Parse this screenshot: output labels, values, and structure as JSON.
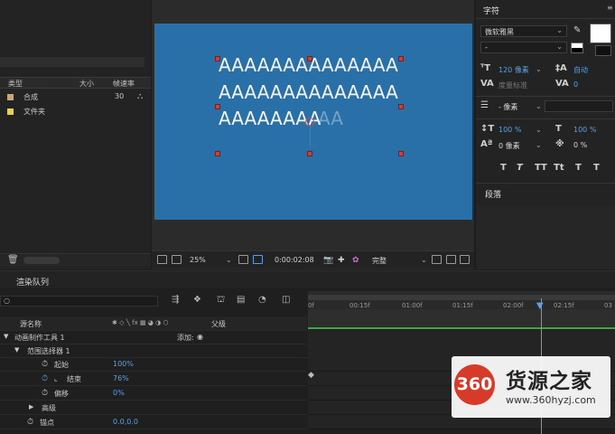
{
  "project": {
    "columns": [
      "类型",
      "大小",
      "帧速率"
    ],
    "items": [
      {
        "name": "合成",
        "fps": "30",
        "color": "#c9a77a"
      },
      {
        "name": "文件夹",
        "fps": "",
        "color": "#e5d15a"
      }
    ]
  },
  "canvas": {
    "lines": [
      "AAAAAAAAAAAAAA",
      "AAAAAAAAAAAAAA",
      "AAAAAAAA"
    ],
    "ghost": "AA",
    "bg_color": "#2a70a8"
  },
  "viewer_toolbar": {
    "zoom": "25%",
    "timecode": "0:00:02:08",
    "resolution": "完整"
  },
  "character": {
    "title": "字符",
    "font_family": "微软雅黑",
    "font_style": "-",
    "font_size": "120 像素",
    "leading": "自动",
    "kerning": "度量标准",
    "tracking": "0",
    "stroke_width": "- 像素",
    "vscale": "100 %",
    "hscale": "100 %",
    "baseline": "0 像素",
    "tsume": "0 %",
    "styles": [
      "T",
      "T",
      "TT",
      "Tt",
      "T",
      "T"
    ]
  },
  "paragraph": {
    "title": "段落"
  },
  "render_queue": {
    "tab": "渲染队列"
  },
  "timeline": {
    "header_source": "源名称",
    "header_parent": "父级",
    "add_label": "添加:",
    "rows": [
      {
        "label": "动画制作工具 1",
        "value": ""
      },
      {
        "label": "范围选择器 1",
        "value": ""
      },
      {
        "label": "起始",
        "value": "100%"
      },
      {
        "label": "结束",
        "value": "76%"
      },
      {
        "label": "偏移",
        "value": "0%"
      },
      {
        "label": "高级",
        "value": ""
      },
      {
        "label": "锚点",
        "value": "0.0,0.0"
      }
    ],
    "ruler": [
      "0f",
      "00:15f",
      "01:00f",
      "01:15f",
      "02:00f",
      "02:15f",
      "03"
    ]
  },
  "watermark": {
    "logo": "360",
    "name": "货源之家",
    "url": "www.360hyzj.com"
  }
}
